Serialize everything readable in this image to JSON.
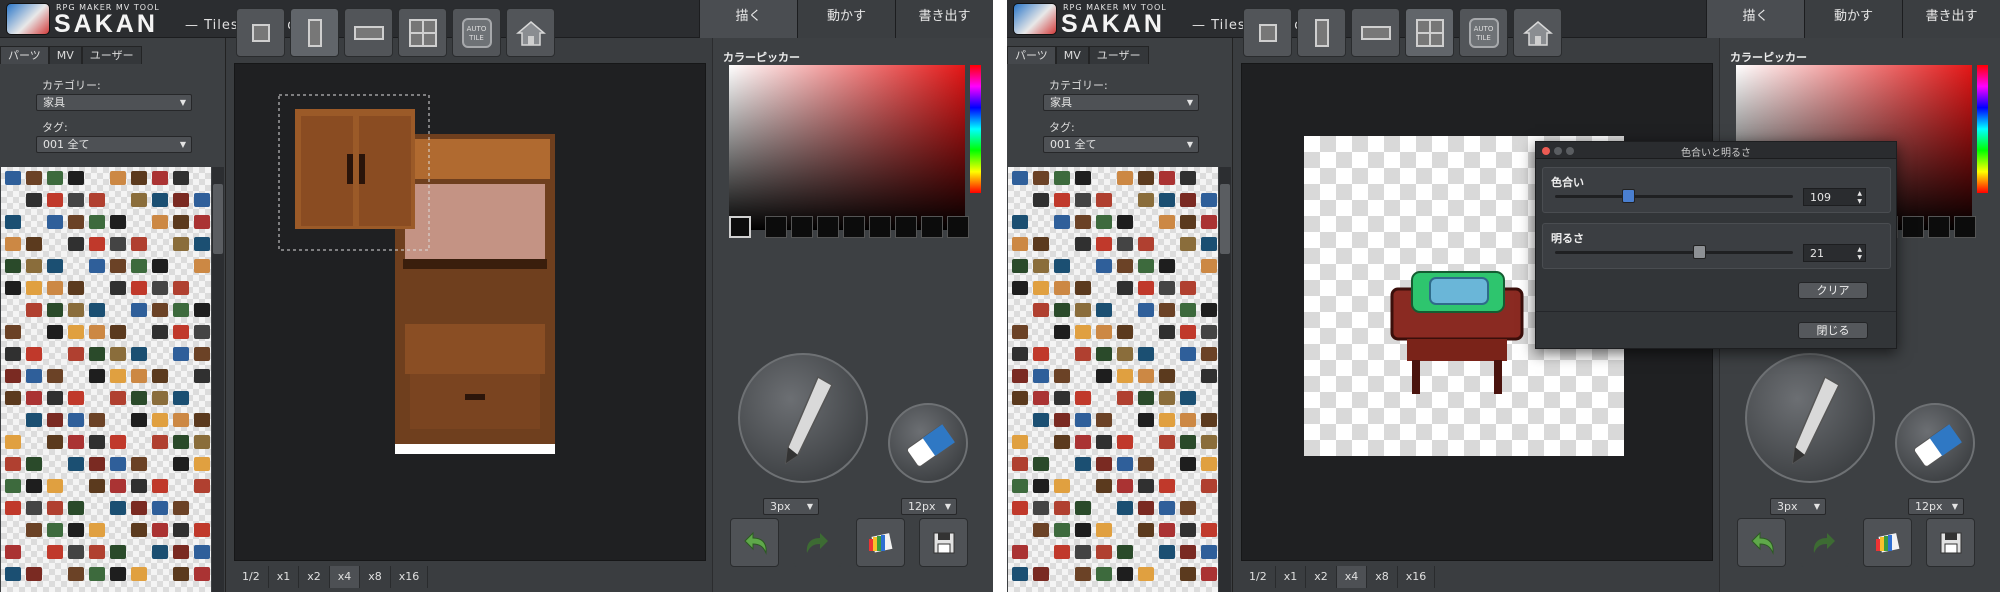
{
  "app": {
    "small_title": "RPG MAKER MV TOOL",
    "title": "SAKAN",
    "subtitle": "— Tileset Builder —",
    "top_tabs": [
      {
        "label": "描く"
      },
      {
        "label": "動かす"
      },
      {
        "label": "書き出す"
      }
    ]
  },
  "sidebar": {
    "tabs": [
      {
        "label": "パーツ"
      },
      {
        "label": "MV"
      },
      {
        "label": "ユーザー"
      }
    ],
    "category_label": "カテゴリー:",
    "category_value": "家具",
    "tag_label": "タグ:",
    "tag_value": "001 全て"
  },
  "zoom": {
    "options": [
      "1/2",
      "x1",
      "x2",
      "x4",
      "x8",
      "x16"
    ],
    "selected": "x4"
  },
  "color_picker": {
    "title": "カラーピッカー",
    "base_hue": "#e41616"
  },
  "tools": {
    "pen_size": "3px",
    "eraser_size": "12px"
  },
  "hue_dialog": {
    "title": "色合いと明るさ",
    "hue_label": "色合い",
    "hue_value": "109",
    "brightness_label": "明るさ",
    "brightness_value": "21",
    "clear_label": "クリア",
    "close_label": "閉じる"
  },
  "colors": {
    "accent_red": "#e41616",
    "panel_bg": "#3a3d40",
    "canvas_bg": "#1f2022",
    "selected_swatch": "#0c0c0c"
  }
}
